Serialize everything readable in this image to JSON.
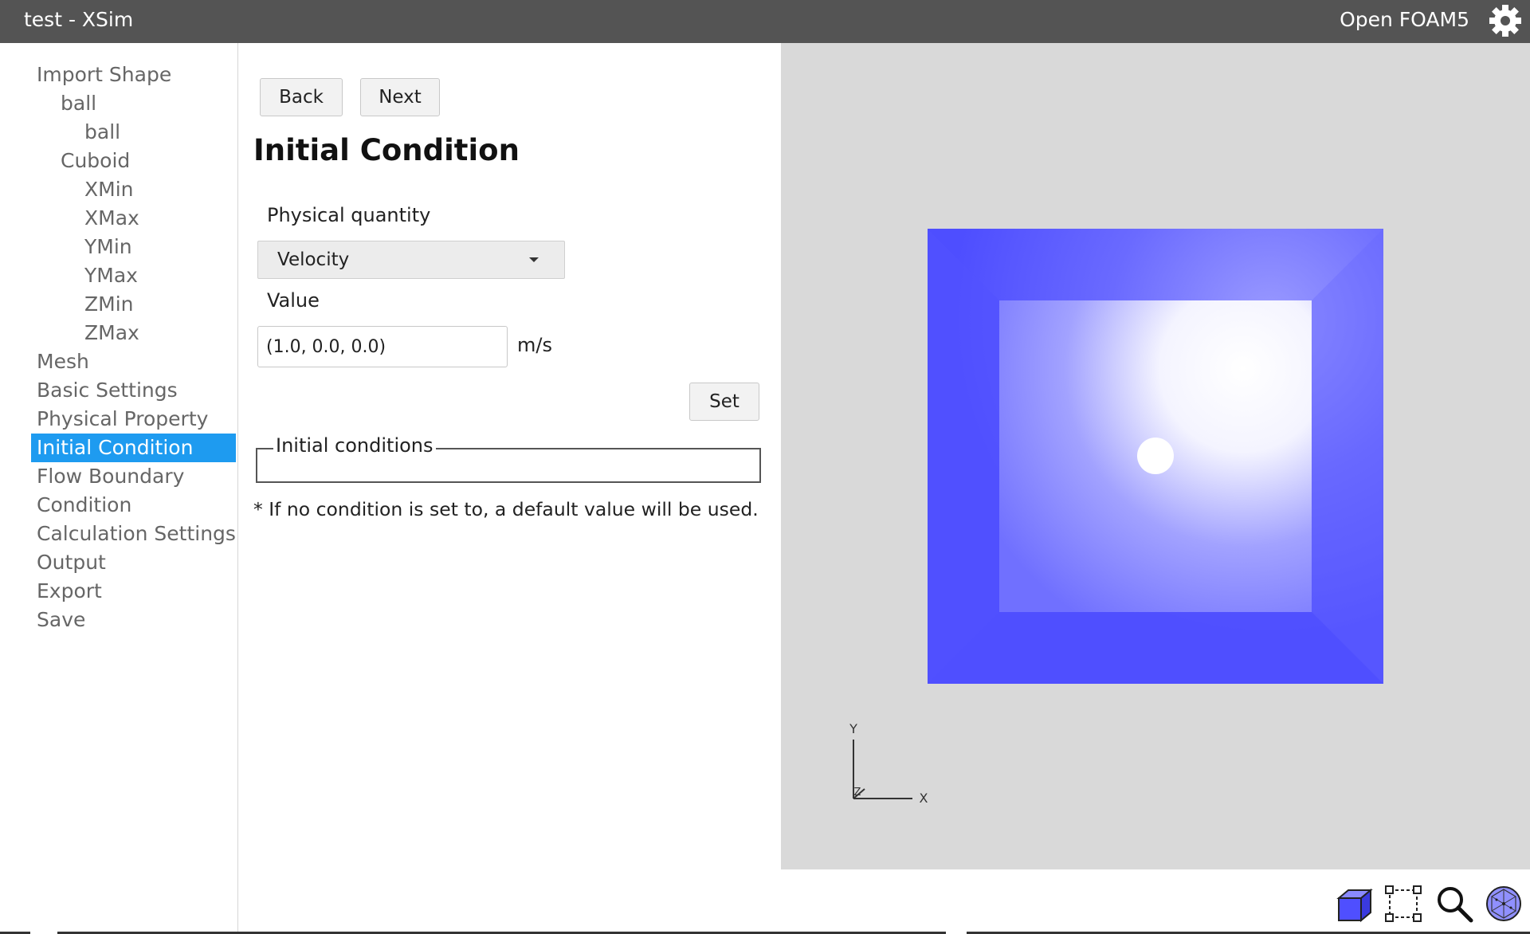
{
  "titlebar": {
    "title": "test - XSim",
    "solver": "Open FOAM5"
  },
  "sidebar": {
    "items": [
      {
        "label": "Import Shape",
        "level": 0,
        "active": false
      },
      {
        "label": "ball",
        "level": 1,
        "active": false
      },
      {
        "label": "ball",
        "level": 2,
        "active": false
      },
      {
        "label": "Cuboid",
        "level": 1,
        "active": false
      },
      {
        "label": "XMin",
        "level": 2,
        "active": false
      },
      {
        "label": "XMax",
        "level": 2,
        "active": false
      },
      {
        "label": "YMin",
        "level": 2,
        "active": false
      },
      {
        "label": "YMax",
        "level": 2,
        "active": false
      },
      {
        "label": "ZMin",
        "level": 2,
        "active": false
      },
      {
        "label": "ZMax",
        "level": 2,
        "active": false
      },
      {
        "label": "Mesh",
        "level": 0,
        "active": false
      },
      {
        "label": "Basic Settings",
        "level": 0,
        "active": false
      },
      {
        "label": "Physical Property",
        "level": 0,
        "active": false
      },
      {
        "label": "Initial Condition",
        "level": 0,
        "active": true
      },
      {
        "label": "Flow Boundary",
        "level": 0,
        "active": false
      },
      {
        "label": "Condition",
        "level": 0,
        "active": false
      },
      {
        "label": "Calculation Settings",
        "level": 0,
        "active": false
      },
      {
        "label": "Output",
        "level": 0,
        "active": false
      },
      {
        "label": "Export",
        "level": 0,
        "active": false
      },
      {
        "label": "Save",
        "level": 0,
        "active": false
      }
    ]
  },
  "panel": {
    "back_label": "Back",
    "next_label": "Next",
    "heading": "Initial Condition",
    "physical_quantity_label": "Physical quantity",
    "physical_quantity_value": "Velocity",
    "value_label": "Value",
    "value_input": "(1.0, 0.0, 0.0)",
    "value_unit": "m/s",
    "set_label": "Set",
    "conditions_legend": "Initial conditions",
    "note": "* If no condition is set to, a default value will be used."
  },
  "viewport": {
    "axis_y": "Y",
    "axis_x": "X",
    "axis_z": "Z",
    "background_color": "#d9d9d9",
    "box_color": "#5050ff"
  },
  "toolbar": {
    "icons": [
      "3d-view-icon",
      "selection-box-icon",
      "zoom-icon",
      "mesh-sphere-icon"
    ]
  },
  "colors": {
    "titlebar_bg": "#545454",
    "active_item_bg": "#1e9bf0"
  }
}
